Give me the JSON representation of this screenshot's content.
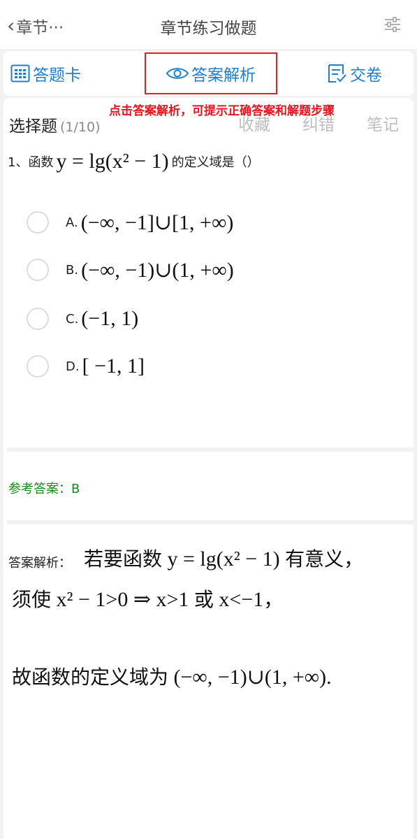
{
  "header": {
    "back_label": "章节···",
    "title": "章节练习做题",
    "settings_icon": "sliders-icon"
  },
  "tabs": [
    {
      "label": "答题卡",
      "icon": "answer-card-icon"
    },
    {
      "label": "答案解析",
      "icon": "eye-icon"
    },
    {
      "label": "交卷",
      "icon": "submit-list-icon"
    }
  ],
  "hint": "点击答案解析，可提示正确答案和解题步骤",
  "question": {
    "type_label": "选择题",
    "progress": "(1/10)",
    "actions": {
      "favorite": "收藏",
      "report_error": "纠错",
      "note": "笔记"
    },
    "number": "1、函数",
    "formula": "y = lg(x² − 1)",
    "stem_suffix": "的定义域是（）",
    "options": [
      {
        "letter": "A.",
        "value": "(−∞, −1]∪[1, +∞)"
      },
      {
        "letter": "B.",
        "value": "(−∞, −1)∪(1, +∞)"
      },
      {
        "letter": "C.",
        "value": "(−1, 1)"
      },
      {
        "letter": "D.",
        "value": "[ −1, 1]"
      }
    ]
  },
  "reference_answer": "参考答案：B",
  "explanation": {
    "label": "答案解析：",
    "line1_prefix": "若要函数",
    "line1_formula": "y = lg(x² − 1)",
    "line1_suffix": "有意义，",
    "line2_prefix": "须使",
    "line2_formula": "x² − 1>0 ⇒ x>1",
    "line2_or": "或",
    "line2_tail": "x<−1",
    "line2_end": "，",
    "line3_prefix": "故函数的定义域为",
    "line3_formula": "(−∞, −1)∪(1, +∞)",
    "line3_end": "."
  },
  "colors": {
    "accent": "#1e7fd1",
    "highlight": "#e02020",
    "answer": "#1a8a1a"
  }
}
